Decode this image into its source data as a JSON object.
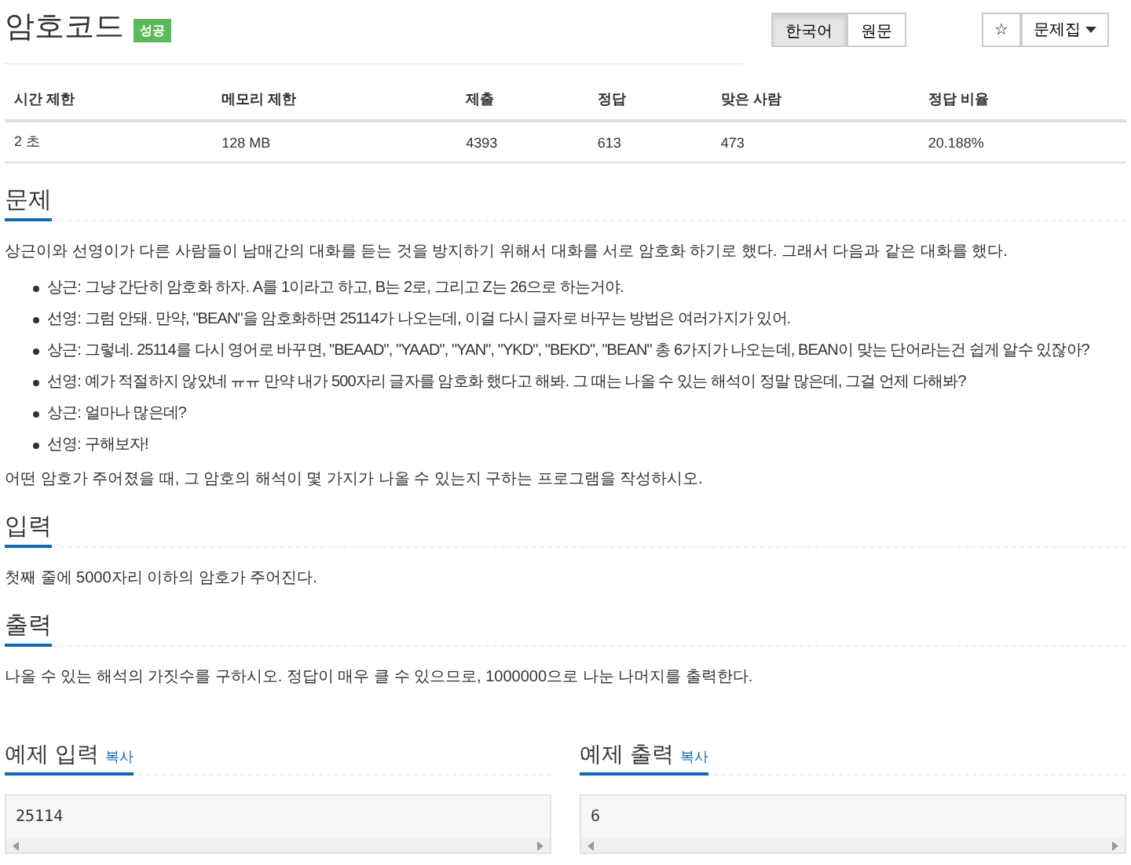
{
  "title": "암호코드",
  "badge": "성공",
  "languages": [
    {
      "label": "한국어",
      "selected": true
    },
    {
      "label": "원문",
      "selected": false
    }
  ],
  "star_button": "☆",
  "problemset_button": "문제집",
  "stats": {
    "columns": [
      "시간 제한",
      "메모리 제한",
      "제출",
      "정답",
      "맞은 사람",
      "정답 비율"
    ],
    "row": [
      "2 초",
      "128 MB",
      "4393",
      "613",
      "473",
      "20.188%"
    ]
  },
  "problem": {
    "heading": "문제",
    "intro": "상근이와 선영이가 다른 사람들이 남매간의 대화를 듣는 것을 방지하기 위해서 대화를 서로 암호화 하기로 했다. 그래서 다음과 같은 대화를 했다.",
    "dialogue": [
      "상근: 그냥 간단히 암호화 하자. A를 1이라고 하고, B는 2로, 그리고 Z는 26으로 하는거야.",
      "선영: 그럼 안돼. 만약, \"BEAN\"을 암호화하면 25114가 나오는데, 이걸 다시 글자로 바꾸는 방법은 여러가지가 있어.",
      "상근: 그렇네. 25114를 다시 영어로 바꾸면, \"BEAAD\", \"YAAD\", \"YAN\", \"YKD\", \"BEKD\", \"BEAN\" 총 6가지가 나오는데, BEAN이 맞는 단어라는건 쉽게 알수 있잖아?",
      "선영: 예가 적절하지 않았네 ㅠㅠ 만약 내가 500자리 글자를 암호화 했다고 해봐. 그 때는 나올 수 있는 해석이 정말 많은데, 그걸 언제 다해봐?",
      "상근: 얼마나 많은데?",
      "선영: 구해보자!"
    ],
    "task": "어떤 암호가 주어졌을 때, 그 암호의 해석이 몇 가지가 나올 수 있는지 구하는 프로그램을 작성하시오."
  },
  "input": {
    "heading": "입력",
    "text": "첫째 줄에 5000자리 이하의 암호가 주어진다."
  },
  "output": {
    "heading": "출력",
    "text": "나올 수 있는 해석의 가짓수를 구하시오. 정답이 매우 클 수 있으므로, 1000000으로 나눈 나머지를 출력한다."
  },
  "samples": [
    {
      "heading": "예제 입력",
      "copy": "복사",
      "value": "25114"
    },
    {
      "heading": "예제 출력",
      "copy": "복사",
      "value": "6"
    }
  ]
}
